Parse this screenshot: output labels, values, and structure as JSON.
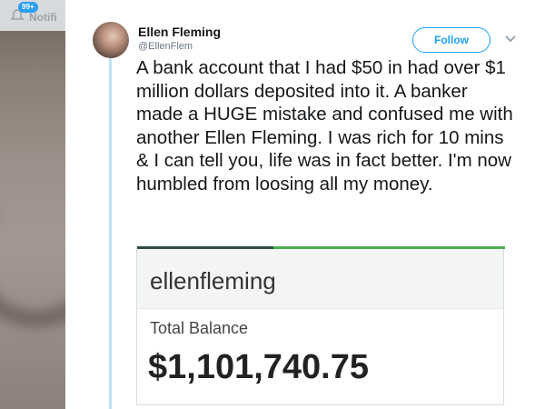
{
  "background": {
    "notification_badge": "99+",
    "notification_text": "Notifi"
  },
  "tweet": {
    "user": {
      "name": "Ellen Fleming",
      "handle": "@EllenFlem"
    },
    "follow_label": "Follow",
    "text": "A bank account that I had $50 in had over $1 million dollars deposited into it. A banker made a HUGE mistake and confused me with another Ellen Fleming. I was rich for 10 mins & I can tell you, life was in fact better. I'm now humbled from loosing all my money.",
    "embed": {
      "account_name": "ellenfleming",
      "balance_label": "Total Balance",
      "balance_value": "$1,101,740.75"
    }
  },
  "colors": {
    "accent": "#1da1f2",
    "thread_line": "#bfe0f9",
    "bank_green": "#4caf50"
  },
  "icons": {
    "notification": "bell-icon",
    "menu": "chevron-down-icon"
  }
}
